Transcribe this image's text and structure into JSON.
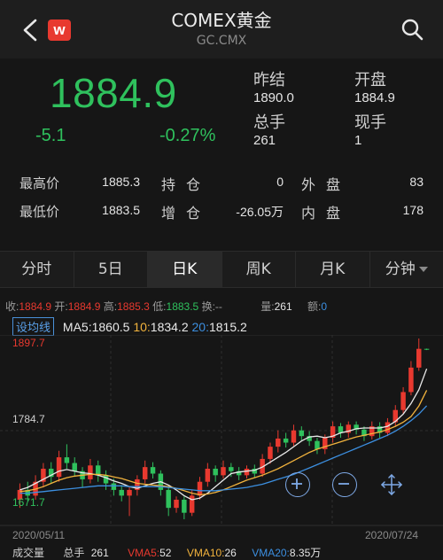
{
  "header": {
    "title": "COMEX黄金",
    "subtitle": "GC.CMX",
    "logo_letter": "w"
  },
  "quote": {
    "price": "1884.9",
    "change": "-5.1",
    "change_pct": "-0.27%",
    "prev_close_label": "昨结",
    "prev_close": "1890.0",
    "open_label": "开盘",
    "open": "1884.9",
    "total_vol_label": "总手",
    "total_vol": "261",
    "current_vol_label": "现手",
    "current_vol": "1"
  },
  "stats": {
    "high_label": "最高价",
    "high": "1885.3",
    "low_label": "最低价",
    "low": "1883.5",
    "hold_label": "持仓",
    "hold": "0",
    "add_label": "增仓",
    "add": "-26.05万",
    "outer_label": "外盘",
    "outer": "83",
    "inner_label": "内盘",
    "inner": "178"
  },
  "tabs": [
    "分时",
    "5日",
    "日K",
    "周K",
    "月K",
    "分钟"
  ],
  "active_tab": "日K",
  "info": {
    "close_label": "收:",
    "close": "1884.9",
    "open_label": "开:",
    "open": "1884.9",
    "high_label": "高:",
    "high": "1885.3",
    "low_label": "低:",
    "low": "1883.5",
    "turn_label": "换:",
    "turn": "--",
    "vol_label": "量:",
    "vol": "261",
    "amount_label": "额:",
    "amount": "0"
  },
  "ma": {
    "tag": "设均线",
    "ma5_label": "MA5:",
    "ma5": "1860.5",
    "ma10_label": "10:",
    "ma10": "1834.2",
    "ma20_label": "20:",
    "ma20": "1815.2"
  },
  "axis": {
    "y_top": "1897.7",
    "y_mid": "1784.7",
    "y_bot": "1671.7",
    "date_start": "2020/05/11",
    "date_end": "2020/07/24"
  },
  "volume": {
    "label": "成交量",
    "hands_label": "总手",
    "hands": "261",
    "vma5_label": "VMA5:",
    "vma5": "52",
    "vma10_label": "VMA10:",
    "vma10": "26",
    "vma20_label": "VMA20:",
    "vma20": "8.35万"
  },
  "colors": {
    "up": "#e8392f",
    "down": "#2fc15d",
    "ma5": "#e9e9e9",
    "ma10": "#f2b33d",
    "ma20": "#3c8fe0"
  },
  "chart_data": {
    "type": "candlestick",
    "ylim": [
      1671.7,
      1897.7
    ],
    "candles": [
      {
        "o": 1700,
        "c": 1712,
        "h": 1720,
        "l": 1690
      },
      {
        "o": 1712,
        "c": 1705,
        "h": 1722,
        "l": 1698
      },
      {
        "o": 1705,
        "c": 1722,
        "h": 1730,
        "l": 1700
      },
      {
        "o": 1722,
        "c": 1738,
        "h": 1745,
        "l": 1715
      },
      {
        "o": 1738,
        "c": 1728,
        "h": 1746,
        "l": 1720
      },
      {
        "o": 1728,
        "c": 1752,
        "h": 1760,
        "l": 1722
      },
      {
        "o": 1752,
        "c": 1745,
        "h": 1768,
        "l": 1738
      },
      {
        "o": 1745,
        "c": 1735,
        "h": 1752,
        "l": 1728
      },
      {
        "o": 1735,
        "c": 1725,
        "h": 1740,
        "l": 1715
      },
      {
        "o": 1725,
        "c": 1742,
        "h": 1750,
        "l": 1720
      },
      {
        "o": 1742,
        "c": 1730,
        "h": 1748,
        "l": 1722
      },
      {
        "o": 1730,
        "c": 1720,
        "h": 1736,
        "l": 1712
      },
      {
        "o": 1720,
        "c": 1712,
        "h": 1726,
        "l": 1705
      },
      {
        "o": 1712,
        "c": 1705,
        "h": 1718,
        "l": 1698
      },
      {
        "o": 1705,
        "c": 1712,
        "h": 1716,
        "l": 1680
      },
      {
        "o": 1712,
        "c": 1725,
        "h": 1730,
        "l": 1705
      },
      {
        "o": 1725,
        "c": 1740,
        "h": 1748,
        "l": 1720
      },
      {
        "o": 1740,
        "c": 1732,
        "h": 1746,
        "l": 1726
      },
      {
        "o": 1732,
        "c": 1712,
        "h": 1736,
        "l": 1705
      },
      {
        "o": 1712,
        "c": 1690,
        "h": 1716,
        "l": 1680
      },
      {
        "o": 1690,
        "c": 1700,
        "h": 1704,
        "l": 1684
      },
      {
        "o": 1700,
        "c": 1684,
        "h": 1704,
        "l": 1676
      },
      {
        "o": 1684,
        "c": 1705,
        "h": 1712,
        "l": 1680
      },
      {
        "o": 1705,
        "c": 1722,
        "h": 1728,
        "l": 1700
      },
      {
        "o": 1722,
        "c": 1738,
        "h": 1745,
        "l": 1716
      },
      {
        "o": 1738,
        "c": 1730,
        "h": 1742,
        "l": 1722
      },
      {
        "o": 1730,
        "c": 1740,
        "h": 1748,
        "l": 1726
      },
      {
        "o": 1740,
        "c": 1735,
        "h": 1745,
        "l": 1728
      },
      {
        "o": 1735,
        "c": 1730,
        "h": 1740,
        "l": 1724
      },
      {
        "o": 1730,
        "c": 1738,
        "h": 1742,
        "l": 1726
      },
      {
        "o": 1738,
        "c": 1732,
        "h": 1743,
        "l": 1727
      },
      {
        "o": 1732,
        "c": 1750,
        "h": 1756,
        "l": 1728
      },
      {
        "o": 1750,
        "c": 1765,
        "h": 1770,
        "l": 1744
      },
      {
        "o": 1765,
        "c": 1775,
        "h": 1785,
        "l": 1758
      },
      {
        "o": 1775,
        "c": 1770,
        "h": 1782,
        "l": 1764
      },
      {
        "o": 1770,
        "c": 1785,
        "h": 1792,
        "l": 1766
      },
      {
        "o": 1785,
        "c": 1778,
        "h": 1790,
        "l": 1772
      },
      {
        "o": 1778,
        "c": 1772,
        "h": 1784,
        "l": 1766
      },
      {
        "o": 1772,
        "c": 1762,
        "h": 1776,
        "l": 1756
      },
      {
        "o": 1762,
        "c": 1776,
        "h": 1780,
        "l": 1756
      },
      {
        "o": 1776,
        "c": 1790,
        "h": 1796,
        "l": 1770
      },
      {
        "o": 1790,
        "c": 1782,
        "h": 1794,
        "l": 1776
      },
      {
        "o": 1782,
        "c": 1792,
        "h": 1796,
        "l": 1776
      },
      {
        "o": 1792,
        "c": 1786,
        "h": 1796,
        "l": 1780
      },
      {
        "o": 1786,
        "c": 1778,
        "h": 1790,
        "l": 1772
      },
      {
        "o": 1778,
        "c": 1790,
        "h": 1796,
        "l": 1774
      },
      {
        "o": 1790,
        "c": 1782,
        "h": 1795,
        "l": 1776
      },
      {
        "o": 1782,
        "c": 1795,
        "h": 1800,
        "l": 1778
      },
      {
        "o": 1795,
        "c": 1810,
        "h": 1816,
        "l": 1790
      },
      {
        "o": 1810,
        "c": 1832,
        "h": 1838,
        "l": 1806
      },
      {
        "o": 1832,
        "c": 1862,
        "h": 1870,
        "l": 1828
      },
      {
        "o": 1862,
        "c": 1885,
        "h": 1897.7,
        "l": 1858
      },
      {
        "o": 1885,
        "c": 1884.9,
        "h": 1885.3,
        "l": 1883.5
      }
    ],
    "ma5": [
      1712,
      1715,
      1720,
      1725,
      1730,
      1735,
      1737,
      1735,
      1733,
      1732,
      1730,
      1727,
      1723,
      1720,
      1716,
      1714,
      1717,
      1720,
      1722,
      1718,
      1712,
      1705,
      1700,
      1702,
      1708,
      1716,
      1724,
      1732,
      1734,
      1735,
      1736,
      1740,
      1746,
      1752,
      1758,
      1765,
      1772,
      1777,
      1778,
      1776,
      1778,
      1782,
      1784,
      1787,
      1788,
      1788,
      1788,
      1790,
      1796,
      1805,
      1818,
      1835,
      1860.5
    ],
    "ma10": [
      1710,
      1711,
      1713,
      1716,
      1720,
      1724,
      1727,
      1729,
      1730,
      1731,
      1731,
      1730,
      1728,
      1726,
      1723,
      1720,
      1719,
      1718,
      1717,
      1716,
      1714,
      1711,
      1708,
      1706,
      1707,
      1709,
      1712,
      1716,
      1720,
      1724,
      1727,
      1730,
      1734,
      1738,
      1743,
      1748,
      1753,
      1758,
      1762,
      1765,
      1768,
      1771,
      1774,
      1777,
      1779,
      1781,
      1783,
      1786,
      1790,
      1795,
      1802,
      1815,
      1834.2
    ],
    "ma20": [
      1708,
      1708,
      1709,
      1710,
      1711,
      1712,
      1713,
      1714,
      1715,
      1716,
      1717,
      1717,
      1717,
      1717,
      1716,
      1716,
      1716,
      1716,
      1716,
      1715,
      1714,
      1713,
      1712,
      1711,
      1711,
      1711,
      1712,
      1713,
      1714,
      1715,
      1717,
      1719,
      1722,
      1725,
      1728,
      1731,
      1735,
      1739,
      1743,
      1747,
      1751,
      1755,
      1759,
      1763,
      1767,
      1771,
      1775,
      1779,
      1784,
      1790,
      1797,
      1805,
      1815.2
    ]
  }
}
